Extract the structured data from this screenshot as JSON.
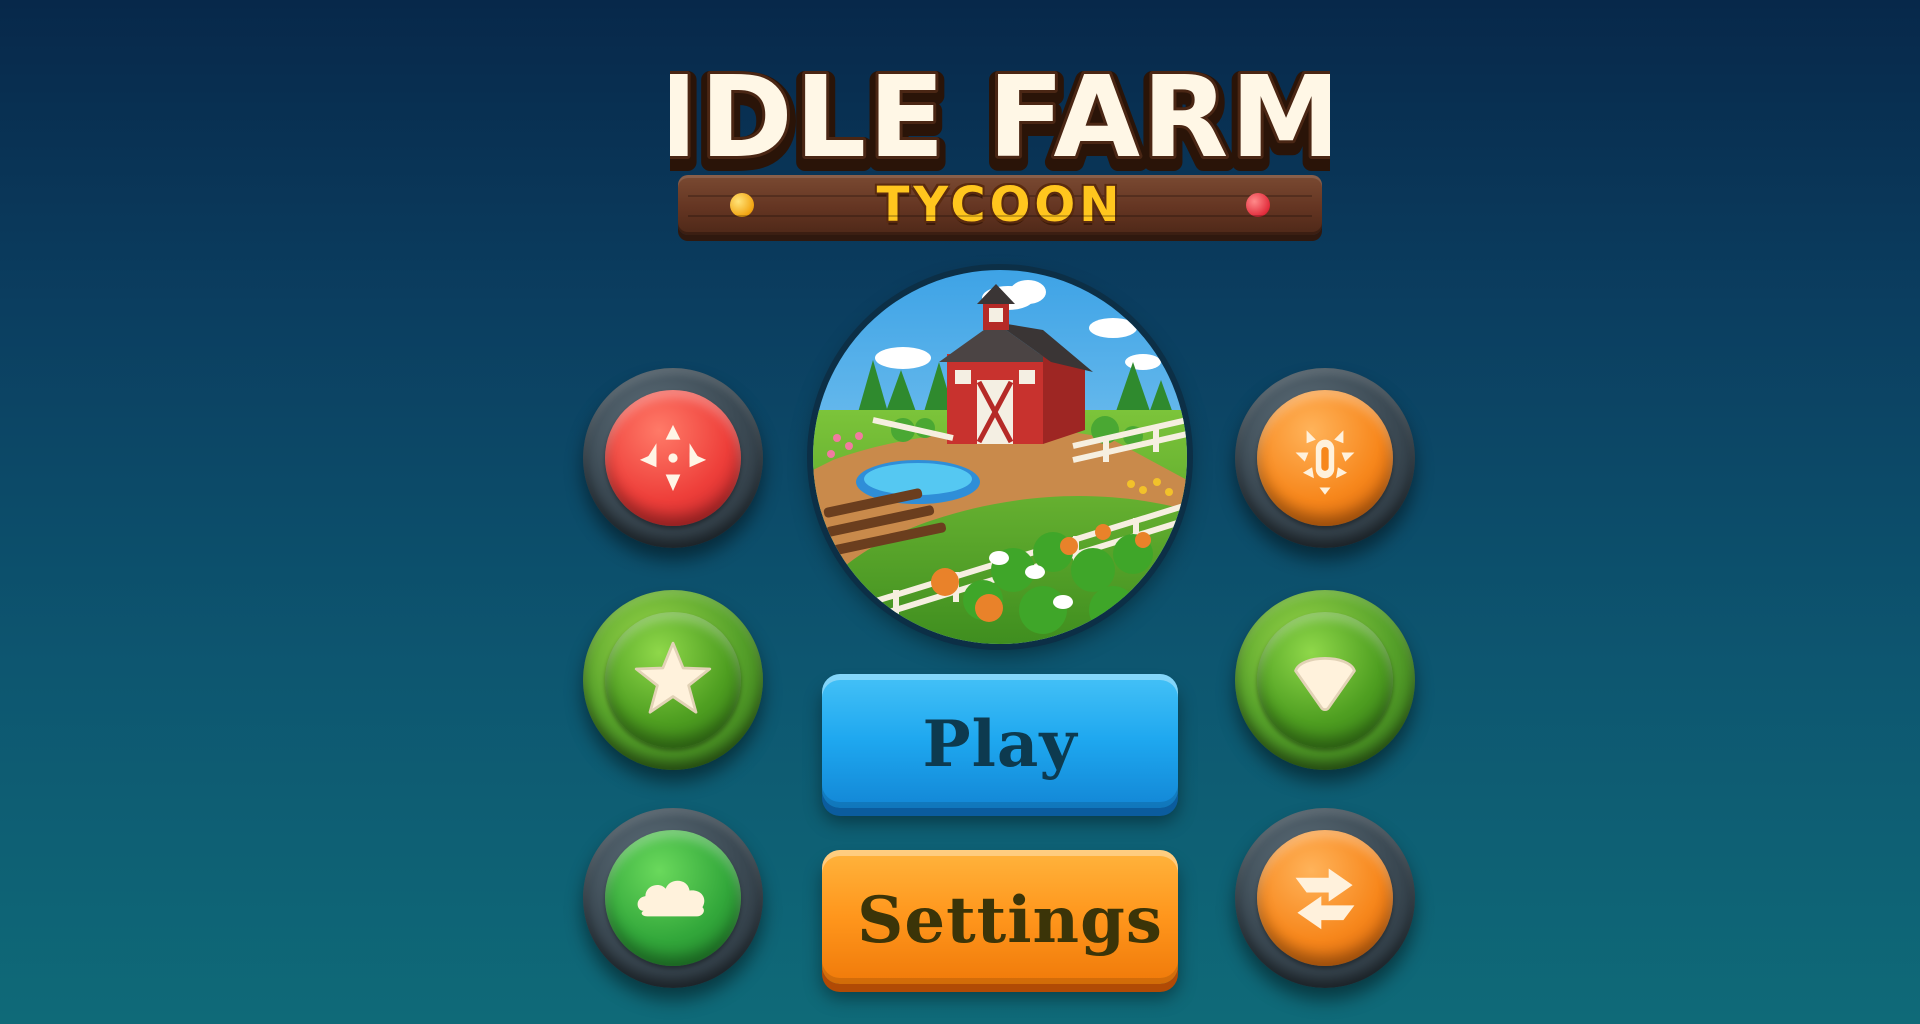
{
  "logo": {
    "title": "IDLE FARM",
    "subtitle": "TYCOON"
  },
  "menu": {
    "play_label": "Play",
    "settings_label": "Settings"
  },
  "side_buttons": {
    "left": [
      {
        "icon": "red-burst-icon",
        "color": "#ee3f3a"
      },
      {
        "icon": "star-icon",
        "color": "#4f9f21"
      },
      {
        "icon": "cloud-icon",
        "color": "#33a83b"
      }
    ],
    "right": [
      {
        "icon": "orange-badge-icon",
        "color": "#f7871c"
      },
      {
        "icon": "gem-icon",
        "color": "#4f9f21"
      },
      {
        "icon": "swap-arrows-icon",
        "color": "#f7871c"
      }
    ]
  },
  "colors": {
    "background_top": "#07284a",
    "background_bottom": "#0f6a78",
    "play_button": "#1ea7ef",
    "settings_button": "#ff961c",
    "logo_text": "#fff7e6",
    "logo_subtitle": "#ffc61e"
  }
}
